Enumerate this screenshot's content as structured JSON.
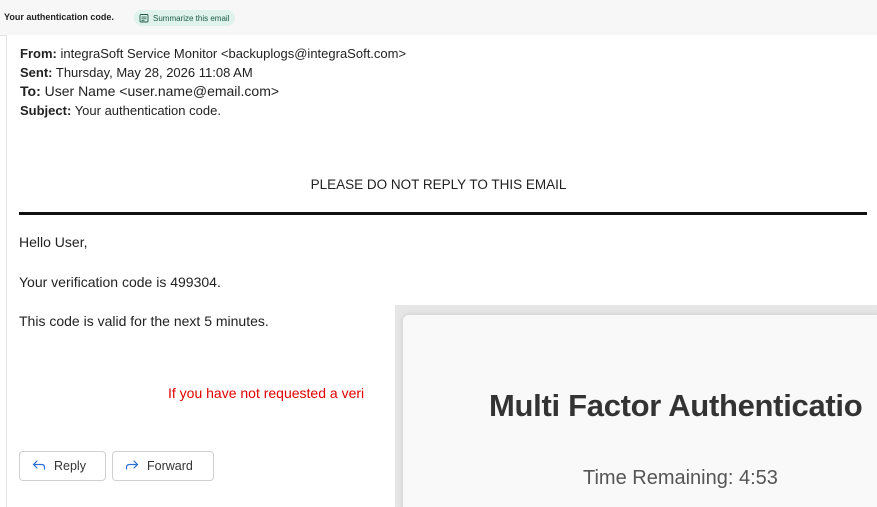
{
  "topbar": {
    "subject": "Your authentication code.",
    "summarize_label": "Summarize this email",
    "summarize_icon": "summarize-icon"
  },
  "email": {
    "from_label": "From:",
    "from_value": "integraSoft Service Monitor <backuplogs@integraSoft.com>",
    "sent_label": "Sent:",
    "sent_value": "Thursday, May 28, 2026 11:08 AM",
    "to_label": "To:",
    "to_value": "User Name <user.name@email.com>",
    "subject_label": "Subject:",
    "subject_value": "Your authentication code.",
    "banner": "PLEASE DO NOT REPLY TO THIS EMAIL",
    "greeting": "Hello User,",
    "code_line": "Your verification code is 499304.",
    "validity_line": "This code is valid for the next 5 minutes.",
    "warning_line": "If you have not requested a veri"
  },
  "actions": {
    "reply_label": "Reply",
    "forward_label": "Forward",
    "reply_icon": "reply-icon",
    "forward_icon": "forward-icon"
  },
  "mfa_window": {
    "title": "Multi Factor Authenticatio",
    "timer": "Time Remaining: 4:53"
  },
  "colors": {
    "warning": "#e00000",
    "accent": "#2a6fd6",
    "pill_bg": "#dff3ec"
  }
}
